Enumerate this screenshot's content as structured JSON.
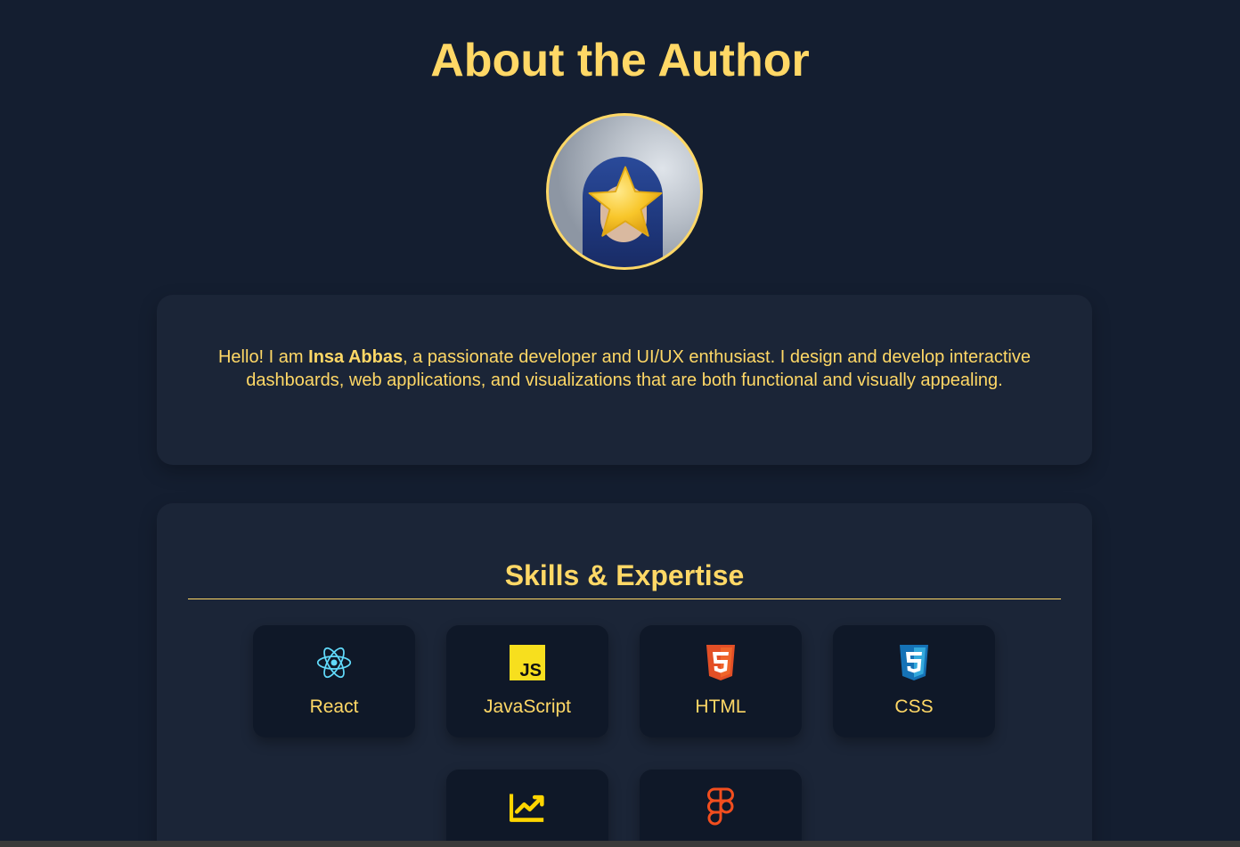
{
  "header": {
    "title": "About the Author"
  },
  "bio": {
    "intro": "Hello! I am ",
    "name": "Insa Abbas",
    "rest": ", a passionate developer and UI/UX enthusiast. I design and develop interactive dashboards, web applications, and visualizations that are both functional and visually appealing."
  },
  "skills": {
    "title": "Skills & Expertise",
    "items": [
      {
        "label": "React",
        "icon": "react-icon",
        "color": "#61dafb"
      },
      {
        "label": "JavaScript",
        "icon": "javascript-icon",
        "color": "#f7df1e"
      },
      {
        "label": "HTML",
        "icon": "html5-icon",
        "color": "#e34f26"
      },
      {
        "label": "CSS",
        "icon": "css3-icon",
        "color": "#1572b6"
      },
      {
        "label": "",
        "icon": "chart-line-icon",
        "color": "#ffd500"
      },
      {
        "label": "",
        "icon": "figma-icon",
        "color": "#f24e1e"
      }
    ]
  },
  "colors": {
    "background": "#141e30",
    "card": "#1b2537",
    "skill_card": "#0f1828",
    "accent": "#ffd866"
  }
}
